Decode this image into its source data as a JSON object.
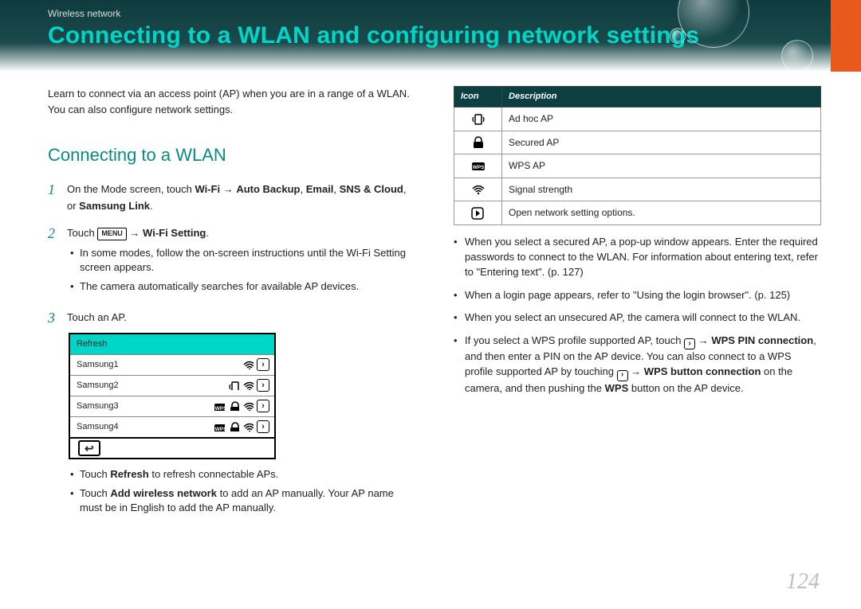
{
  "header": {
    "breadcrumb": "Wireless network",
    "title": "Connecting to a WLAN and configuring network settings"
  },
  "intro": "Learn to connect via an access point (AP) when you are in a range of a WLAN. You can also configure network settings.",
  "section_title": "Connecting to a WLAN",
  "step1": {
    "num": "1",
    "pre": "On the Mode screen, touch ",
    "b1": "Wi-Fi",
    "arr1": " → ",
    "b2": "Auto Backup",
    "sep1": ", ",
    "b3": "Email",
    "sep2": ", ",
    "b4": "SNS & Cloud",
    "sep3": ", or ",
    "b5": "Samsung Link",
    "end": "."
  },
  "step2": {
    "num": "2",
    "pre": "Touch ",
    "menu_label": "MENU",
    "arr": " → ",
    "b1": "Wi-Fi Setting",
    "end": ".",
    "sub1": "In some modes, follow the on-screen instructions until the Wi-Fi Setting screen appears.",
    "sub2": "The camera automatically searches for available AP devices."
  },
  "step3": {
    "num": "3",
    "text": "Touch an AP.",
    "refresh": "Refresh",
    "rows": [
      "Samsung1",
      "Samsung2",
      "Samsung3",
      "Samsung4"
    ],
    "back_glyph": "↩",
    "sub1_pre": "Touch ",
    "sub1_b": "Refresh",
    "sub1_post": " to refresh connectable APs.",
    "sub2_pre": "Touch ",
    "sub2_b": "Add wireless network",
    "sub2_post": " to add an AP manually. Your AP name must be in English to add the AP manually."
  },
  "table": {
    "h_icon": "Icon",
    "h_desc": "Description",
    "rows": [
      {
        "desc": "Ad hoc AP",
        "icon": "adhoc"
      },
      {
        "desc": "Secured AP",
        "icon": "lock"
      },
      {
        "desc": "WPS AP",
        "icon": "wps"
      },
      {
        "desc": "Signal strength",
        "icon": "wifi"
      },
      {
        "desc": "Open network setting options.",
        "icon": "chev"
      }
    ]
  },
  "right_bullets": {
    "b1": "When you select a secured AP, a pop-up window appears. Enter the required passwords to connect to the WLAN. For information about entering text, refer to \"Entering text\". (p. 127)",
    "b2": "When a login page appears, refer to \"Using the login browser\". (p. 125)",
    "b3": "When you select an unsecured AP, the camera will connect to the WLAN.",
    "b4_pre": "If you select a WPS profile supported AP, touch ",
    "b4_arr1": " → ",
    "b4_b1": "WPS PIN connection",
    "b4_mid": ", and then enter a PIN on the AP device. You can also connect to a WPS profile supported AP by touching ",
    "b4_arr2": " → ",
    "b4_b2": "WPS button connection",
    "b4_mid2": " on the camera, and then pushing the ",
    "b4_b3": "WPS",
    "b4_end": " button on the AP device."
  },
  "page_number": "124"
}
